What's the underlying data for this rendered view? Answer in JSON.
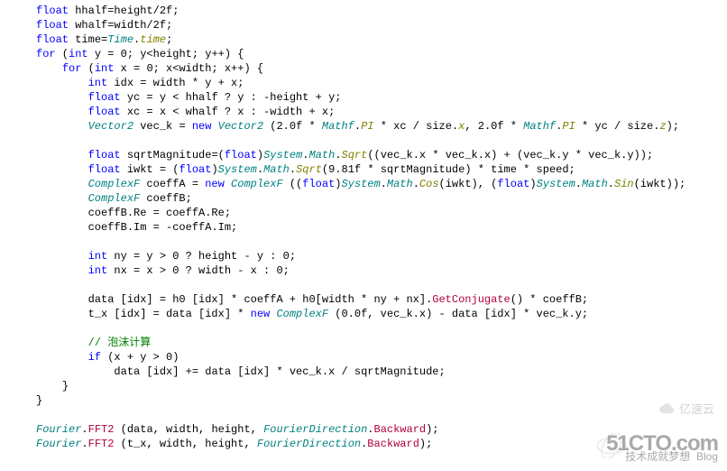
{
  "code": {
    "l01a": "float",
    "l01b": " hhalf=height/2f;",
    "l02a": "float",
    "l02b": " whalf=width/2f;",
    "l03a": "float",
    "l03b": " time=",
    "l03c": "Time",
    "l03d": ".",
    "l03e": "time",
    "l03f": ";",
    "l04a": "for",
    "l04b": " (",
    "l04c": "int",
    "l04d": " y = 0; y<height; y++) {",
    "l05a": "for",
    "l05b": " (",
    "l05c": "int",
    "l05d": " x = 0; x<width; x++) {",
    "l06a": "int",
    "l06b": " idx = width * y + x;",
    "l07a": "float",
    "l07b": " yc = y < hhalf ? y : -height + y;",
    "l08a": "float",
    "l08b": " xc = x < whalf ? x : -width + x;",
    "l09a": "Vector2",
    "l09b": " vec_k = ",
    "l09c": "new",
    "l09d": " ",
    "l09e": "Vector2",
    "l09f": " (2.0f * ",
    "l09g": "Mathf",
    "l09h": ".",
    "l09i": "PI",
    "l09j": " * xc / size.",
    "l09k": "x",
    "l09l": ", 2.0f * ",
    "l09m": "Mathf",
    "l09n": ".",
    "l09o": "PI",
    "l09p": " * yc / size.",
    "l09q": "z",
    "l09r": ");",
    "l10a": "float",
    "l10b": " sqrtMagnitude=(",
    "l10c": "float",
    "l10d": ")",
    "l10e": "System",
    "l10f": ".",
    "l10g": "Math",
    "l10h": ".",
    "l10i": "Sqrt",
    "l10j": "((vec_k.x * vec_k.x) + (vec_k.y * vec_k.y));",
    "l11a": "float",
    "l11b": " iwkt = (",
    "l11c": "float",
    "l11d": ")",
    "l11e": "System",
    "l11f": ".",
    "l11g": "Math",
    "l11h": ".",
    "l11i": "Sqrt",
    "l11j": "(9.81f * sqrtMagnitude) * time * speed;",
    "l12a": "ComplexF",
    "l12b": " coeffA = ",
    "l12c": "new",
    "l12d": " ",
    "l12e": "ComplexF",
    "l12f": " ((",
    "l12g": "float",
    "l12h": ")",
    "l12i": "System",
    "l12j": ".",
    "l12k": "Math",
    "l12l": ".",
    "l12m": "Cos",
    "l12n": "(iwkt), (",
    "l12o": "float",
    "l12p": ")",
    "l12q": "System",
    "l12r": ".",
    "l12s": "Math",
    "l12t": ".",
    "l12u": "Sin",
    "l12v": "(iwkt));",
    "l13a": "ComplexF",
    "l13b": " coeffB;",
    "l14": "coeffB.Re = coeffA.Re;",
    "l15": "coeffB.Im = -coeffA.Im;",
    "l16a": "int",
    "l16b": " ny = y > 0 ? height - y : 0;",
    "l17a": "int",
    "l17b": " nx = x > 0 ? width - x : 0;",
    "l18a": "data [idx] = h0 [idx] * coeffA + h0[width * ny + nx].",
    "l18b": "GetConjugate",
    "l18c": "() * coeffB;",
    "l19a": "t_x [idx] = data [idx] * ",
    "l19b": "new",
    "l19c": " ",
    "l19d": "ComplexF",
    "l19e": " (0.0f, vec_k.x) - data [idx] * vec_k.y;",
    "l20": "// 泡沫计算",
    "l21a": "if",
    "l21b": " (x + y > 0)",
    "l22": "data [idx] += data [idx] * vec_k.x / sqrtMagnitude;",
    "l23": "}",
    "l24": "}",
    "l25a": "Fourier",
    "l25b": ".",
    "l25c": "FFT2",
    "l25d": " (data, width, height, ",
    "l25e": "FourierDirection",
    "l25f": ".",
    "l25g": "Backward",
    "l25h": ");",
    "l26a": "Fourier",
    "l26b": ".",
    "l26c": "FFT2",
    "l26d": " (t_x, width, height, ",
    "l26e": "FourierDirection",
    "l26f": ".",
    "l26g": "Backward",
    "l26h": ");"
  },
  "watermark": {
    "main": "51CTO.com",
    "sub_left": "技术成就梦想",
    "sub_right": "Blog",
    "alt": "亿速云"
  }
}
